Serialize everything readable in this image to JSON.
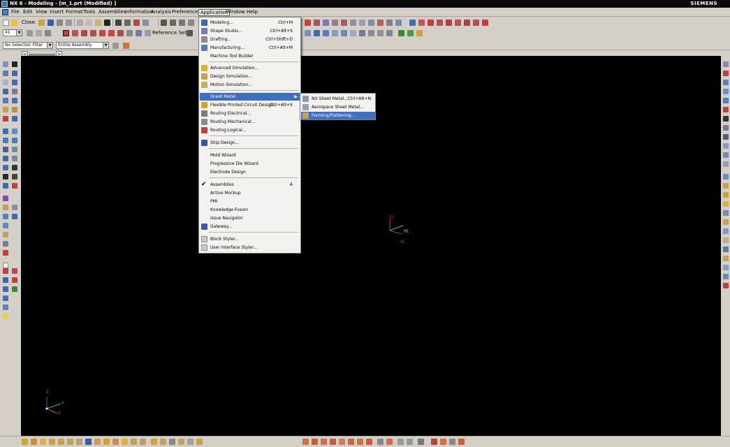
{
  "window": {
    "title": "NX 6 - Modeling - [m_1.prt (Modified) ]",
    "brand": "SIEMENS"
  },
  "menubar": [
    "File",
    "Edit",
    "View",
    "Insert",
    "Format",
    "Tools",
    "Assemblies",
    "Information",
    "Analysis",
    "Preferences",
    "Application",
    "Window",
    "Help"
  ],
  "toolbar": {
    "close_label": "Close",
    "reference_sets_label": "Reference Sets",
    "layer_value": "41"
  },
  "selection_bar": {
    "filter": "No Selection Filter",
    "scope": "Entire Assembly"
  },
  "application_menu": {
    "groups": [
      [
        {
          "label": "Modeling...",
          "shortcut": "Ctrl+M"
        },
        {
          "label": "Shape Studio...",
          "shortcut": "Ctrl+Alt+S"
        },
        {
          "label": "Drafting...",
          "shortcut": "Ctrl+Shift+D"
        },
        {
          "label": "Manufacturing...",
          "shortcut": "Ctrl+Alt+M"
        },
        {
          "label": "Machine Tool Builder",
          "shortcut": ""
        }
      ],
      [
        {
          "label": "Advanced Simulation...",
          "shortcut": ""
        },
        {
          "label": "Design Simulation...",
          "shortcut": ""
        },
        {
          "label": "Motion Simulation...",
          "shortcut": ""
        }
      ],
      [
        {
          "label": "Sheet Metal",
          "shortcut": ""
        },
        {
          "label": "Flexible Printed Circuit Design...",
          "shortcut": "Ctrl+Alt+X"
        },
        {
          "label": "Routing Electrical...",
          "shortcut": ""
        },
        {
          "label": "Routing Mechanical...",
          "shortcut": ""
        },
        {
          "label": "Routing Logical...",
          "shortcut": ""
        }
      ],
      [
        {
          "label": "Ship Design...",
          "shortcut": ""
        }
      ],
      [
        {
          "label": "Mold Wizard",
          "shortcut": ""
        },
        {
          "label": "Progressive Die Wizard",
          "shortcut": ""
        },
        {
          "label": "Electrode Design",
          "shortcut": ""
        }
      ],
      [
        {
          "label": "Assemblies",
          "shortcut": "A"
        },
        {
          "label": "Active Mockup",
          "shortcut": ""
        },
        {
          "label": "PMI",
          "shortcut": ""
        },
        {
          "label": "Knowledge Fusion",
          "shortcut": ""
        },
        {
          "label": "Issue Navigator",
          "shortcut": ""
        },
        {
          "label": "Gateway...",
          "shortcut": ""
        }
      ],
      [
        {
          "label": "Block Styler...",
          "shortcut": ""
        },
        {
          "label": "User Interface Styler...",
          "shortcut": ""
        }
      ]
    ]
  },
  "sheet_metal_submenu": [
    {
      "label": "NX Sheet Metal...",
      "shortcut": "Ctrl+Alt+N"
    },
    {
      "label": "Aerospace Sheet Metal...",
      "shortcut": ""
    },
    {
      "label": "Forming/Flattening...",
      "shortcut": ""
    }
  ],
  "triad": {
    "zc": "ZC",
    "yc": "YC",
    "xc": "XC"
  },
  "mini_triad": {
    "z": "Z",
    "y": "Y",
    "x": "X"
  },
  "colors": {
    "menu_highlight": "#3d6fc4",
    "graphics_bg": "#000000",
    "chrome": "#d4d0c8"
  }
}
